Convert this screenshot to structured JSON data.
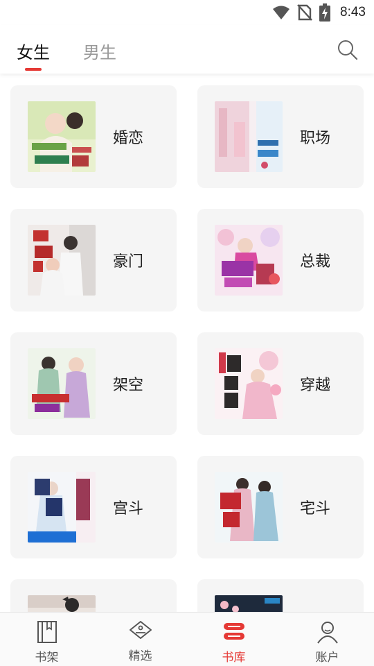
{
  "status_bar": {
    "time": "8:43",
    "icons": [
      "wifi-icon",
      "no-sim-icon",
      "battery-charging-icon"
    ]
  },
  "header": {
    "tabs": [
      {
        "label": "女生",
        "active": true
      },
      {
        "label": "男生",
        "active": false
      }
    ],
    "search_icon": "search-icon",
    "accent_color": "#e53935"
  },
  "categories": [
    {
      "label": "婚恋"
    },
    {
      "label": "职场"
    },
    {
      "label": "豪门"
    },
    {
      "label": "总裁"
    },
    {
      "label": "架空"
    },
    {
      "label": "穿越"
    },
    {
      "label": "宫斗"
    },
    {
      "label": "宅斗"
    },
    {
      "label": ""
    },
    {
      "label": ""
    }
  ],
  "bottom_nav": [
    {
      "label": "书架",
      "icon": "bookshelf-icon",
      "active": false
    },
    {
      "label": "精选",
      "icon": "tag-icon",
      "active": false
    },
    {
      "label": "书库",
      "icon": "library-icon",
      "active": true
    },
    {
      "label": "账户",
      "icon": "account-icon",
      "active": false
    }
  ],
  "colors": {
    "accent": "#e53935",
    "card_bg": "#f5f5f5",
    "inactive_text": "#999999"
  }
}
